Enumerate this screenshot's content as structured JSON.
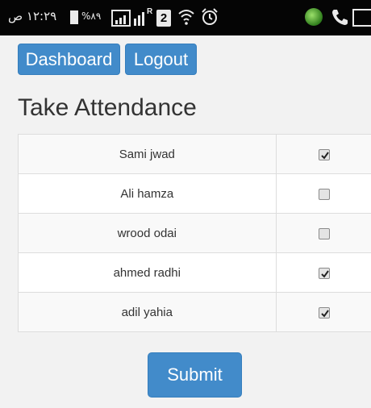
{
  "status_bar": {
    "time": "١٢:٢٩ ص",
    "battery": "%٨٩"
  },
  "nav": {
    "dashboard_label": "Dashboard",
    "logout_label": "Logout"
  },
  "page_title": "Take Attendance",
  "students": [
    {
      "name": "Sami jwad",
      "present": true
    },
    {
      "name": "Ali hamza",
      "present": false
    },
    {
      "name": "wrood odai",
      "present": false
    },
    {
      "name": "ahmed radhi",
      "present": true
    },
    {
      "name": "adil yahia",
      "present": true
    }
  ],
  "submit_label": "Submit",
  "colors": {
    "primary": "#428bca",
    "status_bar": "#050505",
    "background": "#f2f2f2"
  }
}
